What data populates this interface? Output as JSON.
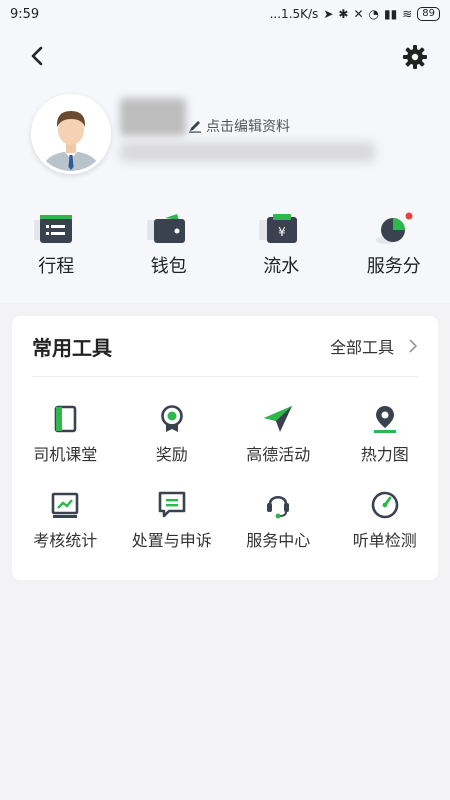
{
  "status": {
    "time": "9:59",
    "speed": "...1.5K/s",
    "battery": "89"
  },
  "profile": {
    "edit_label": "点击编辑资料"
  },
  "quick_actions": [
    {
      "label": "行程",
      "icon": "trip-icon"
    },
    {
      "label": "钱包",
      "icon": "wallet-icon"
    },
    {
      "label": "流水",
      "icon": "ledger-icon"
    },
    {
      "label": "服务分",
      "icon": "service-score-icon"
    }
  ],
  "tools": {
    "title": "常用工具",
    "more_label": "全部工具",
    "items": [
      {
        "label": "司机课堂",
        "icon": "book-icon"
      },
      {
        "label": "奖励",
        "icon": "medal-icon"
      },
      {
        "label": "高德活动",
        "icon": "paper-plane-icon"
      },
      {
        "label": "热力图",
        "icon": "map-pin-icon"
      },
      {
        "label": "考核统计",
        "icon": "chart-icon"
      },
      {
        "label": "处置与申诉",
        "icon": "message-icon"
      },
      {
        "label": "服务中心",
        "icon": "headset-icon"
      },
      {
        "label": "听单检测",
        "icon": "gauge-icon"
      }
    ]
  },
  "colors": {
    "accent": "#2db84b",
    "dark": "#3a4250"
  }
}
